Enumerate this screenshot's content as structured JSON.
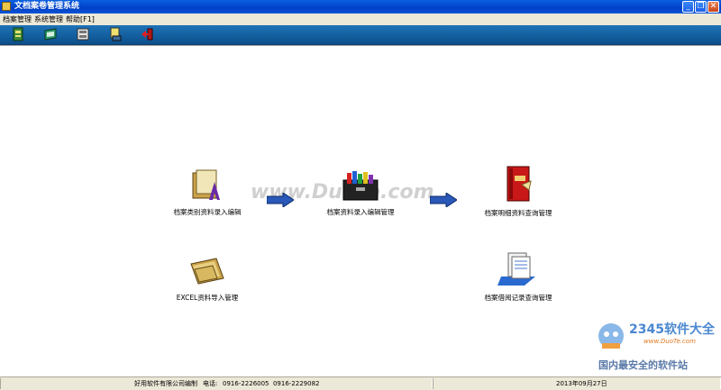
{
  "window": {
    "title": "文档案卷管理系统",
    "min_glyph": "_",
    "max_glyph": "❐",
    "close_glyph": "✕"
  },
  "menu": {
    "items": [
      "档案管理",
      "系统管理",
      "帮助[F1]"
    ]
  },
  "toolbar": {
    "icons": [
      "binder-icon",
      "book-icon",
      "cabinet-icon",
      "document-scan-icon",
      "exit-icon"
    ]
  },
  "workflow": {
    "category_entry": "档案类别资料录入编辑",
    "data_entry": "档案资料录入编辑管理",
    "detail_query": "档案明细资料查询管理",
    "excel_import": "EXCEL资料导入管理",
    "borrow_query": "档案借阅记录查询管理"
  },
  "status": {
    "company": "好用软件有限公司编制",
    "phone_label": "电话:",
    "phones": "0916-2226005  0916-2229082",
    "date": "2013年09月27日"
  },
  "watermarks": {
    "center": "www.DuoTe.com",
    "brand_digits": "2345软件大全",
    "brand_url": "www.DuoTe.com",
    "brand_slogan": "国内最安全的软件站"
  },
  "colors": {
    "titlebar": "#0a5fe0",
    "toolbar": "#1e73b8",
    "arrow": "#2a58b8"
  }
}
